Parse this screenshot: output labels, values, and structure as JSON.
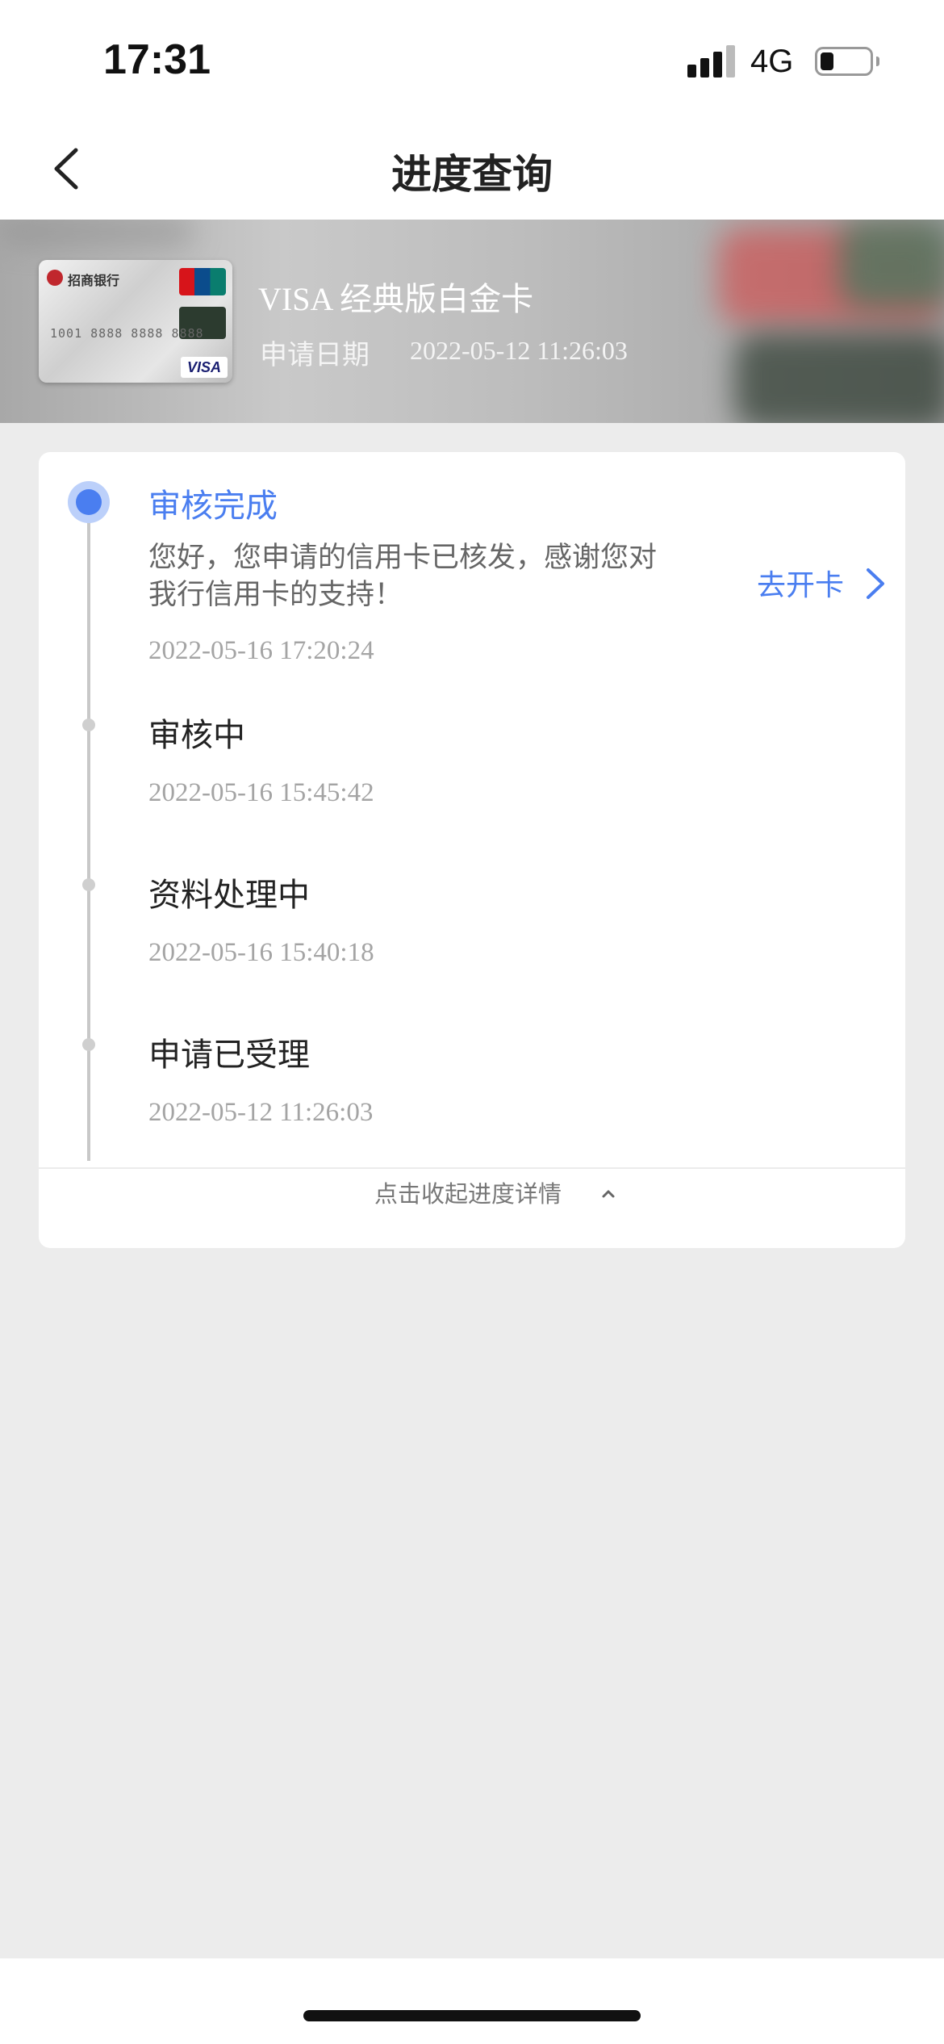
{
  "status_bar": {
    "time": "17:31",
    "network": "4G",
    "battery_level": 0.2
  },
  "nav": {
    "title": "进度查询",
    "back_icon": "chevron-left-icon"
  },
  "card": {
    "bank_name": "招商银行",
    "card_number": "1001 8888 8888 8888",
    "network_badge": "VISA",
    "name": "VISA 经典版白金卡",
    "apply_label": "申请日期",
    "apply_date": "2022-05-12 11:26:03"
  },
  "progress": {
    "steps": [
      {
        "title": "审核完成",
        "description": "您好，您申请的信用卡已核发，感谢您对我行信用卡的支持！",
        "time": "2022-05-16 17:20:24",
        "active": true
      },
      {
        "title": "审核中",
        "time": "2022-05-16 15:45:42"
      },
      {
        "title": "资料处理中",
        "time": "2022-05-16 15:40:18"
      },
      {
        "title": "申请已受理",
        "time": "2022-05-12 11:26:03"
      }
    ],
    "action_label": "去开卡",
    "collapse_label": "点击收起进度详情"
  },
  "colors": {
    "accent": "#4a7ef0",
    "background": "#ececec"
  }
}
